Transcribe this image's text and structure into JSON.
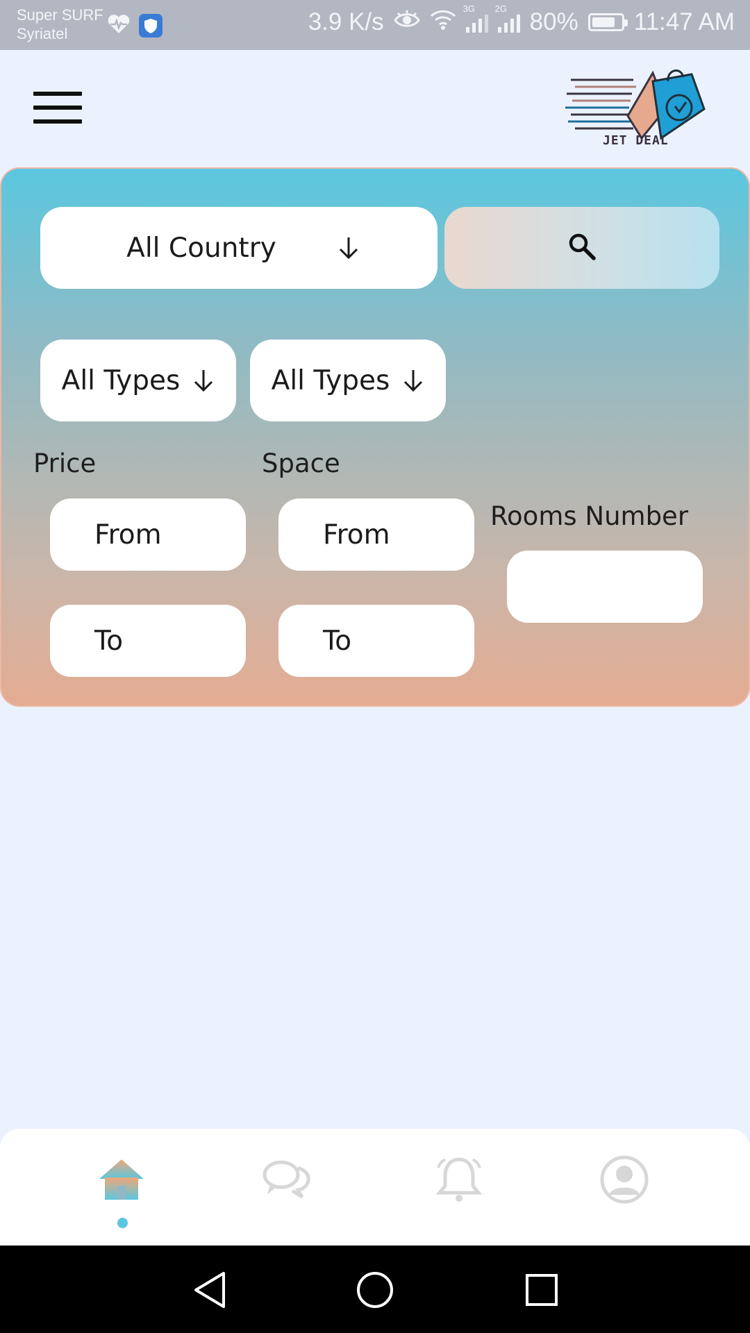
{
  "status_bar": {
    "carrier_line1": "Super SURF",
    "carrier_line2": "Syriatel",
    "speed": "3.9 K/s",
    "net_3g": "3G",
    "net_2g": "2G",
    "battery": "80%",
    "battery_level": 0.8,
    "time": "11:47 AM"
  },
  "header": {
    "logo_text": "JET DEAL"
  },
  "filters": {
    "country": "All Country",
    "type_1": "All Types",
    "type_2": "All Types",
    "price_label": "Price",
    "space_label": "Space",
    "rooms_label": "Rooms Number",
    "price_from_placeholder": "From",
    "price_to_placeholder": "To",
    "space_from_placeholder": "From",
    "space_to_placeholder": "To",
    "rooms_value": ""
  },
  "bottom_nav": {
    "items": [
      "home",
      "chat",
      "notifications",
      "profile"
    ],
    "active": "home",
    "active_color": "#5bc7df",
    "inactive_color": "#d7d7d7"
  },
  "colors": {
    "panel_top": "#5bc7df",
    "panel_bottom": "#e4ac92",
    "background": "#ecf1fe"
  }
}
